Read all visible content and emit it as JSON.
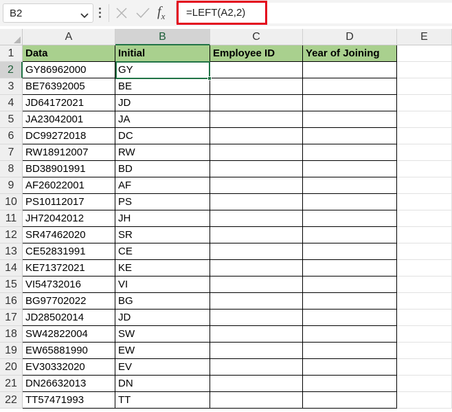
{
  "formula_bar": {
    "name_box": "B2",
    "fx_label": "fx",
    "formula": "=LEFT(A2,2)"
  },
  "columns": [
    "A",
    "B",
    "C",
    "D",
    "E"
  ],
  "rows": [
    "1",
    "2",
    "3",
    "4",
    "5",
    "6",
    "7",
    "8",
    "9",
    "10",
    "11",
    "12",
    "13",
    "14",
    "15",
    "16",
    "17",
    "18",
    "19",
    "20",
    "21",
    "22"
  ],
  "headers": [
    "Data",
    "Initial",
    "Employee ID",
    "Year of Joining"
  ],
  "records": [
    [
      "GY86962000",
      "GY",
      "",
      ""
    ],
    [
      "BE76392005",
      "BE",
      "",
      ""
    ],
    [
      "JD64172021",
      "JD",
      "",
      ""
    ],
    [
      "JA23042001",
      "JA",
      "",
      ""
    ],
    [
      "DC99272018",
      "DC",
      "",
      ""
    ],
    [
      "RW18912007",
      "RW",
      "",
      ""
    ],
    [
      "BD38901991",
      "BD",
      "",
      ""
    ],
    [
      "AF26022001",
      "AF",
      "",
      ""
    ],
    [
      "PS10112017",
      "PS",
      "",
      ""
    ],
    [
      "JH72042012",
      "JH",
      "",
      ""
    ],
    [
      "SR47462020",
      "SR",
      "",
      ""
    ],
    [
      "CE52831991",
      "CE",
      "",
      ""
    ],
    [
      "KE71372021",
      "KE",
      "",
      ""
    ],
    [
      "VI54732016",
      "VI",
      "",
      ""
    ],
    [
      "BG97702022",
      "BG",
      "",
      ""
    ],
    [
      "JD28502014",
      "JD",
      "",
      ""
    ],
    [
      "SW42822004",
      "SW",
      "",
      ""
    ],
    [
      "EW65881990",
      "EW",
      "",
      ""
    ],
    [
      "EV30332020",
      "EV",
      "",
      ""
    ],
    [
      "DN26632013",
      "DN",
      "",
      ""
    ],
    [
      "TT57471993",
      "TT",
      "",
      ""
    ]
  ],
  "colors": {
    "header_fill": "#a9d08e",
    "selection": "#217346",
    "highlight_box": "#e3001b"
  }
}
